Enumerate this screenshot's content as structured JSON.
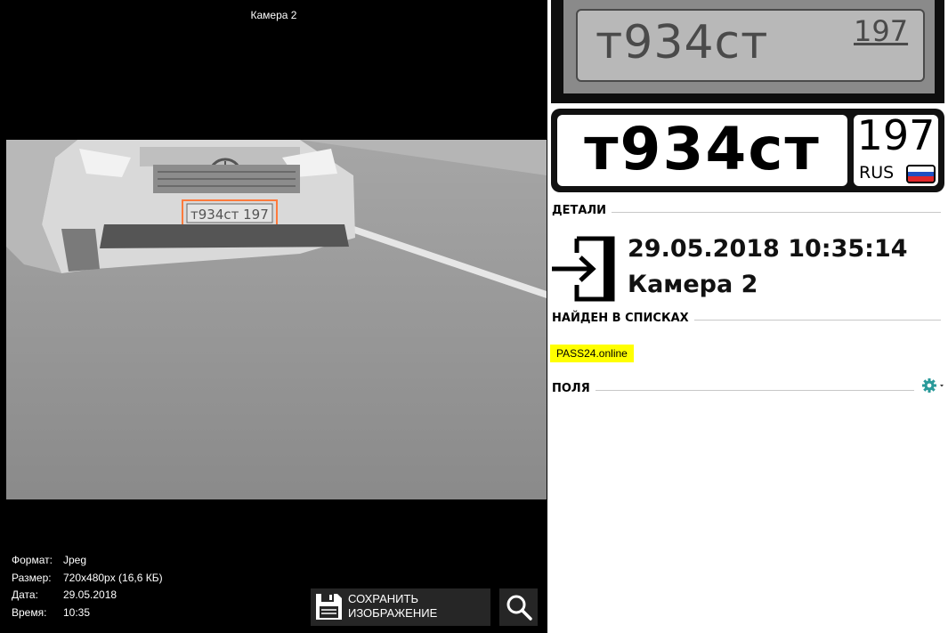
{
  "camera_view": {
    "title": "Камера 2",
    "plate_on_image": "т934ст 197"
  },
  "image_info": [
    {
      "key": "Формат:",
      "value": "Jpeg"
    },
    {
      "key": "Размер:",
      "value": "720x480px (16,6 КБ)"
    },
    {
      "key": "Дата:",
      "value": "29.05.2018"
    },
    {
      "key": "Время:",
      "value": "10:35"
    }
  ],
  "toolbar": {
    "save_line1": "СОХРАНИТЬ",
    "save_line2": "ИЗОБРАЖЕНИЕ",
    "save_icon": "floppy-disk-icon",
    "zoom_icon": "magnifier-icon"
  },
  "plate": {
    "crop_main": "т934ст",
    "crop_region": "197",
    "main": "т934ст",
    "region": "197",
    "country": "RUS",
    "flag_colors": [
      "#ffffff",
      "#1f4fc2",
      "#e0262a"
    ]
  },
  "details": {
    "section_label": "ДЕТАЛИ",
    "datetime": "29.05.2018 10:35:14",
    "camera": "Камера 2",
    "direction_icon": "entry-arrow-icon"
  },
  "lists": {
    "section_label": "НАЙДЕН В СПИСКАХ",
    "items": [
      "PASS24.online"
    ],
    "highlight_color": "#ffff00"
  },
  "fields": {
    "section_label": "ПОЛЯ",
    "settings_icon": "gear-icon",
    "accent_color": "#2a9a9a"
  }
}
